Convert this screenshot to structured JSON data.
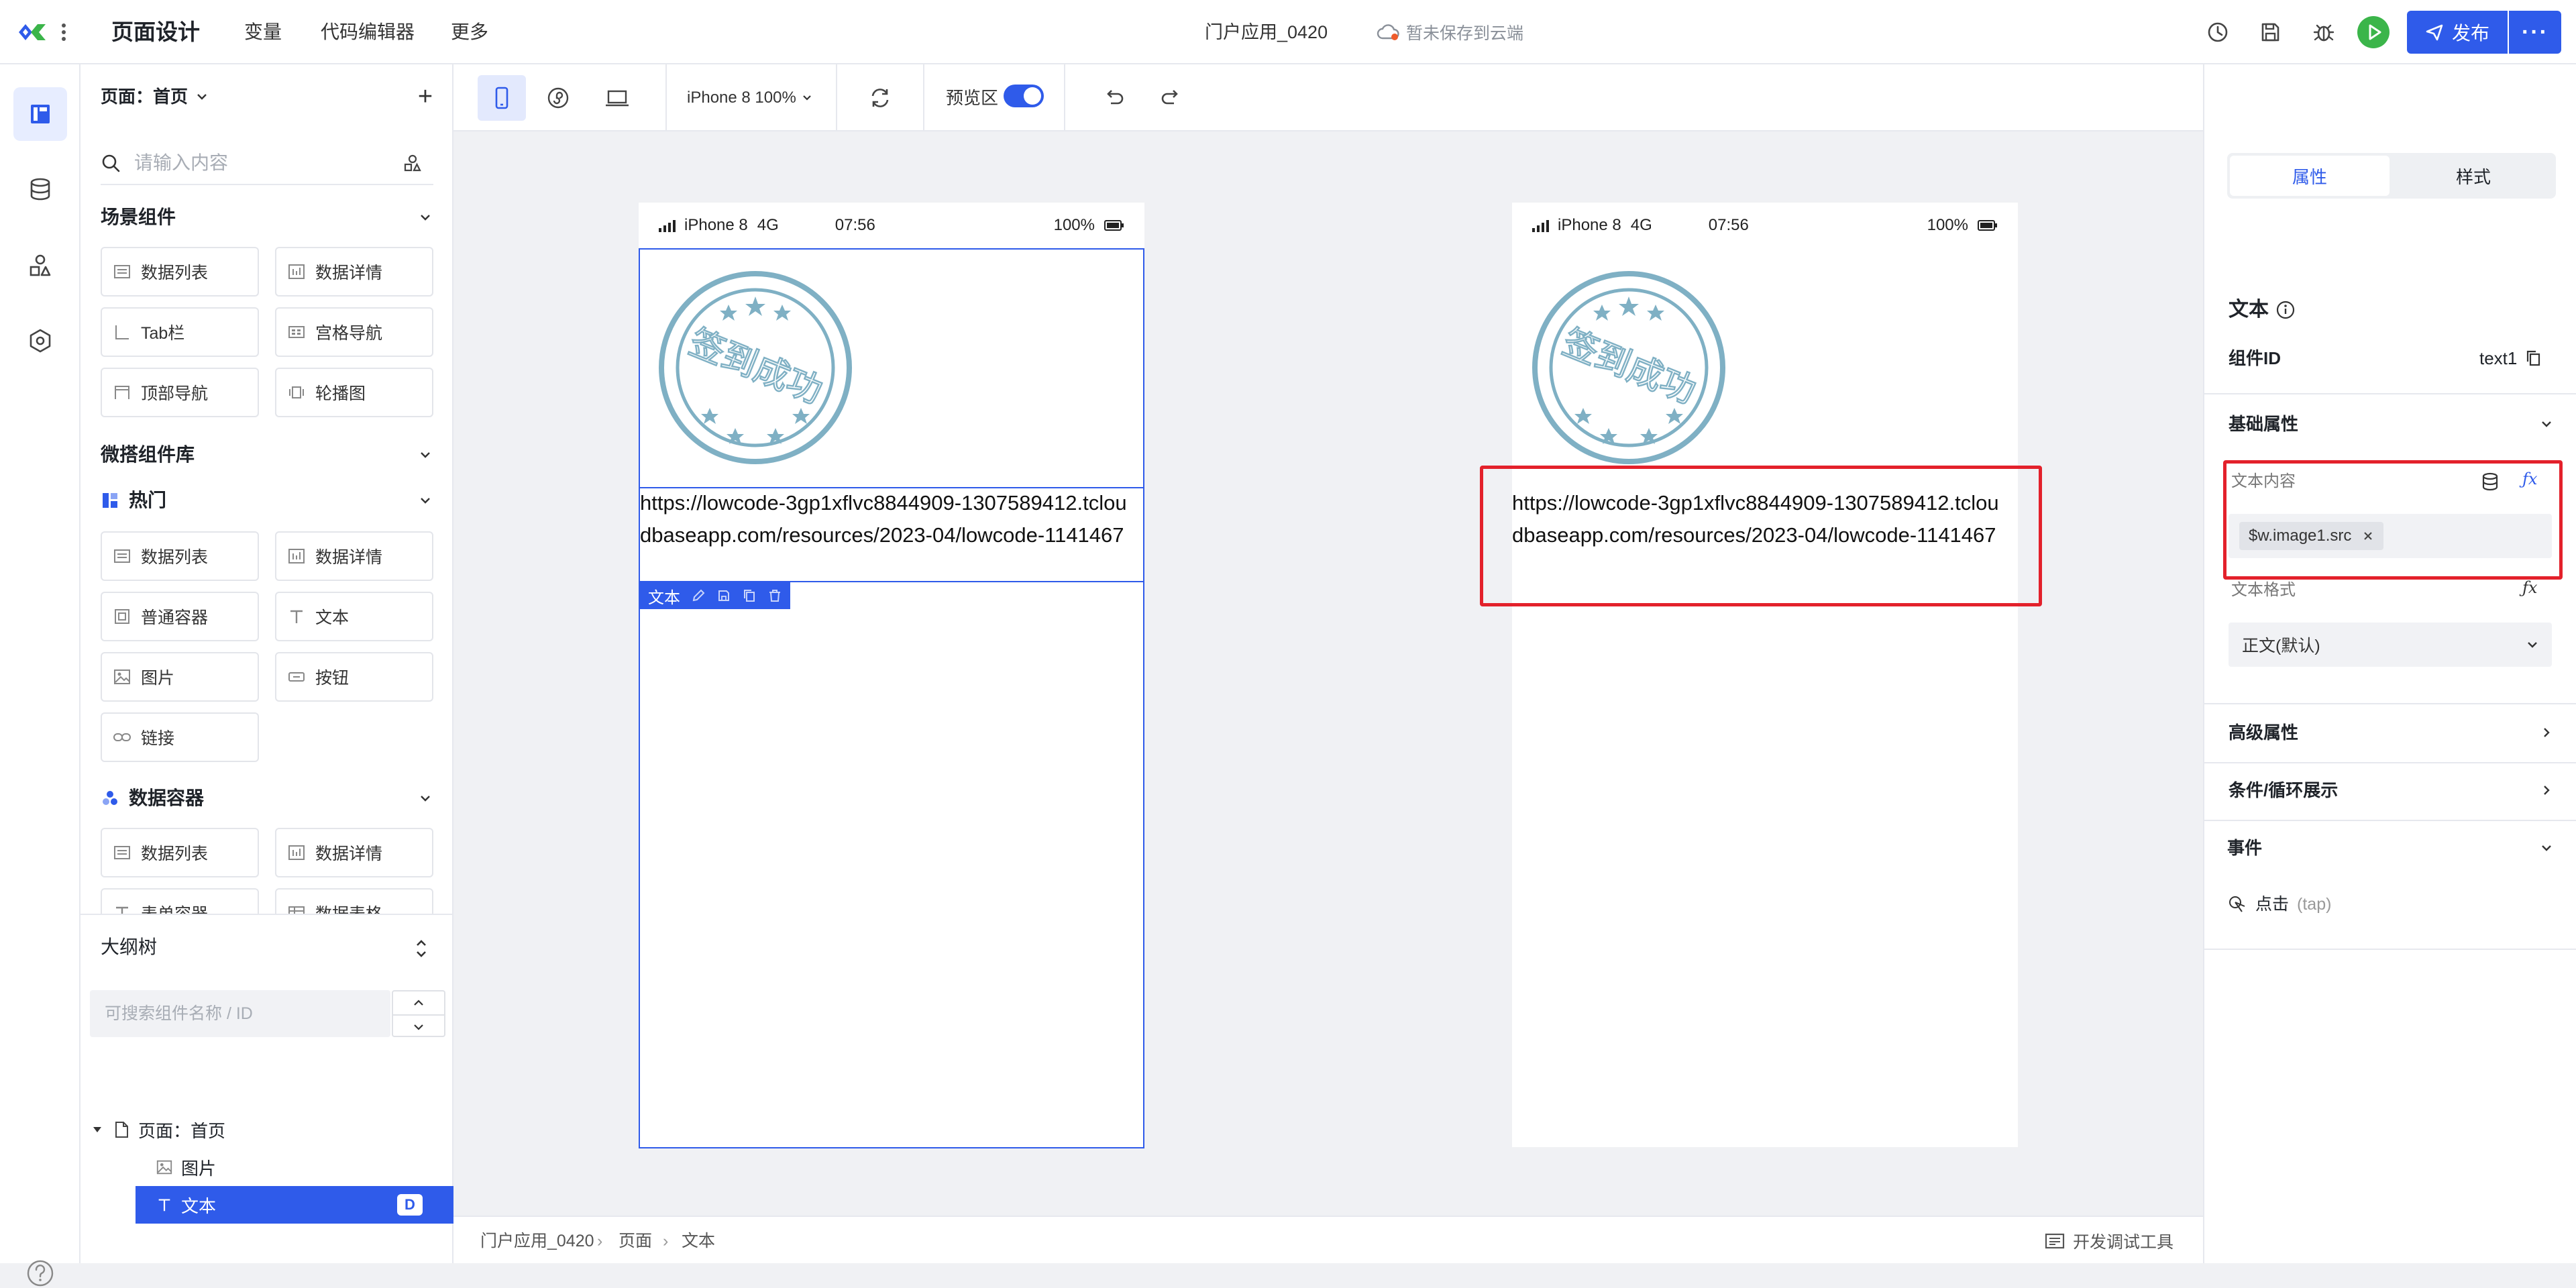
{
  "topbar": {
    "title": "页面设计",
    "menu": [
      "变量",
      "代码编辑器",
      "更多"
    ],
    "doc_name": "门户应用_0420",
    "save_status": "暂未保存到云端",
    "publish_label": "发布",
    "more_label": "···"
  },
  "left_panel": {
    "page_label": "页面：首页",
    "add_label": "+",
    "search_placeholder": "请输入内容",
    "sections": [
      {
        "title": "场景组件",
        "items": [
          "数据列表",
          "数据详情",
          "Tab栏",
          "宫格导航",
          "顶部导航",
          "轮播图"
        ]
      },
      {
        "title": "微搭组件库",
        "items": []
      },
      {
        "title": "热门",
        "items": [
          "数据列表",
          "数据详情",
          "普通容器",
          "文本",
          "图片",
          "按钮",
          "链接"
        ]
      },
      {
        "title": "数据容器",
        "items": [
          "数据列表",
          "数据详情",
          "表单容器",
          "数据表格"
        ]
      }
    ],
    "outline": {
      "title": "大纲树",
      "search_placeholder": "可搜索组件名称 / ID",
      "nodes": [
        {
          "label": "页面：首页"
        },
        {
          "label": "图片"
        },
        {
          "label": "文本",
          "badge": "D"
        }
      ]
    }
  },
  "canvas_toolbar": {
    "device_label": "iPhone 8 100%",
    "preview_label": "预览区"
  },
  "phones": [
    {
      "status": {
        "carrier": "iPhone 8",
        "network": "4G",
        "time": "07:56",
        "battery": "100%"
      },
      "stamp_text": "签到成功",
      "url": "https://lowcode-3gp1xflvc8844909-1307589412.tcloudbaseapp.com/resources/2023-04/lowcode-1141467",
      "text_toolbar_label": "文本"
    },
    {
      "status": {
        "carrier": "iPhone 8",
        "network": "4G",
        "time": "07:56",
        "battery": "100%"
      },
      "stamp_text": "签到成功",
      "url": "https://lowcode-3gp1xflvc8844909-1307589412.tcloudbaseapp.com/resources/2023-04/lowcode-1141467"
    }
  ],
  "bottom_bar": {
    "breadcrumbs": [
      "门户应用_0420",
      "页面",
      "文本"
    ],
    "devtools_label": "开发调试工具"
  },
  "right_panel": {
    "tabs": [
      "属性",
      "样式"
    ],
    "component_title": "文本",
    "component_id_label": "组件ID",
    "component_id": "text1",
    "basic_section": "基础属性",
    "text_content_label": "文本内容",
    "bound_value": "$w.image1.src",
    "text_format_label": "文本格式",
    "text_format_value": "正文(默认)",
    "advanced_section": "高级属性",
    "condition_section": "条件/循环展示",
    "events_section": "事件",
    "event_item": "点击",
    "event_code": "(tap)"
  },
  "colors": {
    "accent": "#2f5bea",
    "highlight": "#e3212b",
    "stamp": "#7fb0c4",
    "run": "#3bb54a"
  }
}
